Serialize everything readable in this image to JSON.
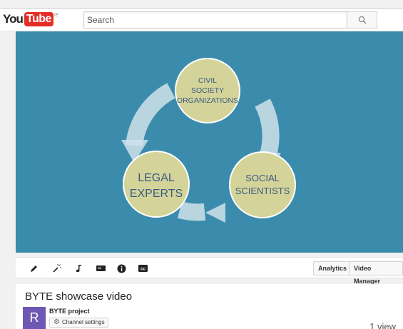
{
  "header": {
    "logo_you": "You",
    "logo_tube": "Tube",
    "logo_region": "IE",
    "search_placeholder": "Search"
  },
  "video": {
    "circles": {
      "top": [
        "CIVIL",
        "SOCIETY",
        "ORGANIZATIONS"
      ],
      "left": [
        "LEGAL",
        "EXPERTS"
      ],
      "right": [
        "SOCIAL",
        "SCIENTISTS"
      ]
    },
    "colors": {
      "background": "#3b8bac",
      "circle": "#d4d49a",
      "arrow": "#cfe2ea",
      "text": "#3d5a80"
    }
  },
  "toolbar": {
    "icons": [
      "pencil-icon",
      "magic-wand-icon",
      "music-note-icon",
      "annotation-icon",
      "info-icon",
      "cc-icon"
    ],
    "analytics_label": "Analytics",
    "video_manager_label": "Video Manager"
  },
  "info": {
    "title": "BYTE showcase video",
    "avatar_letter": "R",
    "channel_name": "BYTE project",
    "channel_settings_label": "Channel settings",
    "views": "1 view"
  }
}
